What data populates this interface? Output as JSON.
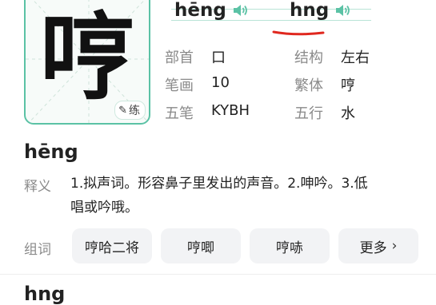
{
  "character": {
    "glyph": "哼",
    "practice_label": "练",
    "practice_icon": "pencil-icon"
  },
  "pinyin": [
    {
      "text": "hēng",
      "icon": "speaker-icon"
    },
    {
      "text": "hng",
      "icon": "speaker-icon"
    }
  ],
  "info": {
    "radical_label": "部首",
    "radical_value": "口",
    "structure_label": "结构",
    "structure_value": "左右",
    "strokes_label": "笔画",
    "strokes_value": "10",
    "traditional_label": "繁体",
    "traditional_value": "哼",
    "wubi_label": "五笔",
    "wubi_value": "KYBH",
    "element_label": "五行",
    "element_value": "水"
  },
  "sections": [
    {
      "pinyin": "hēng",
      "meaning_label": "释义",
      "meaning_line1": "1.拟声词。形容鼻子里发出的声音。2.呻吟。3.低",
      "meaning_line2": "唱或吟哦。",
      "words_label": "组词",
      "words": [
        "哼哈二将",
        "哼唧",
        "哼哧"
      ],
      "more_label": "更多"
    },
    {
      "pinyin": "hng"
    }
  ],
  "colors": {
    "accent": "#5bc2a5",
    "underline": "#e0281f"
  }
}
